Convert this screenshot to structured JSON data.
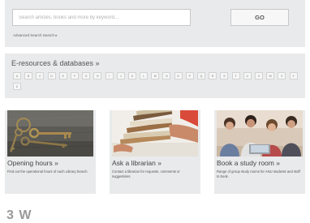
{
  "search": {
    "placeholder": "Search articles, books and more by keyword...",
    "go_label": "GO",
    "advanced_label": "Advanced Search Search",
    "advanced_caret": "▸"
  },
  "eresources": {
    "title": "E-resources & databases »",
    "letters": [
      "A",
      "B",
      "C",
      "D",
      "E",
      "F",
      "G",
      "H",
      "I",
      "J",
      "K",
      "L",
      "M",
      "N",
      "O",
      "P",
      "Q",
      "R",
      "S",
      "T",
      "U",
      "V",
      "W",
      "X",
      "Y",
      "Z"
    ]
  },
  "cards": [
    {
      "title": "Opening hours »",
      "description": "Find out the operational hours of each Library branch.",
      "image": "keys-photo"
    },
    {
      "title": "Ask a librarian »",
      "description": "Contact a librarian for requests, comments or suggestions.",
      "image": "books-photo"
    },
    {
      "title": "Book a study room »",
      "description": "Range of group study rooms for ANU students and staff to book.",
      "image": "students-photo"
    }
  ],
  "bottom": {
    "partial_heading": "3 W"
  }
}
